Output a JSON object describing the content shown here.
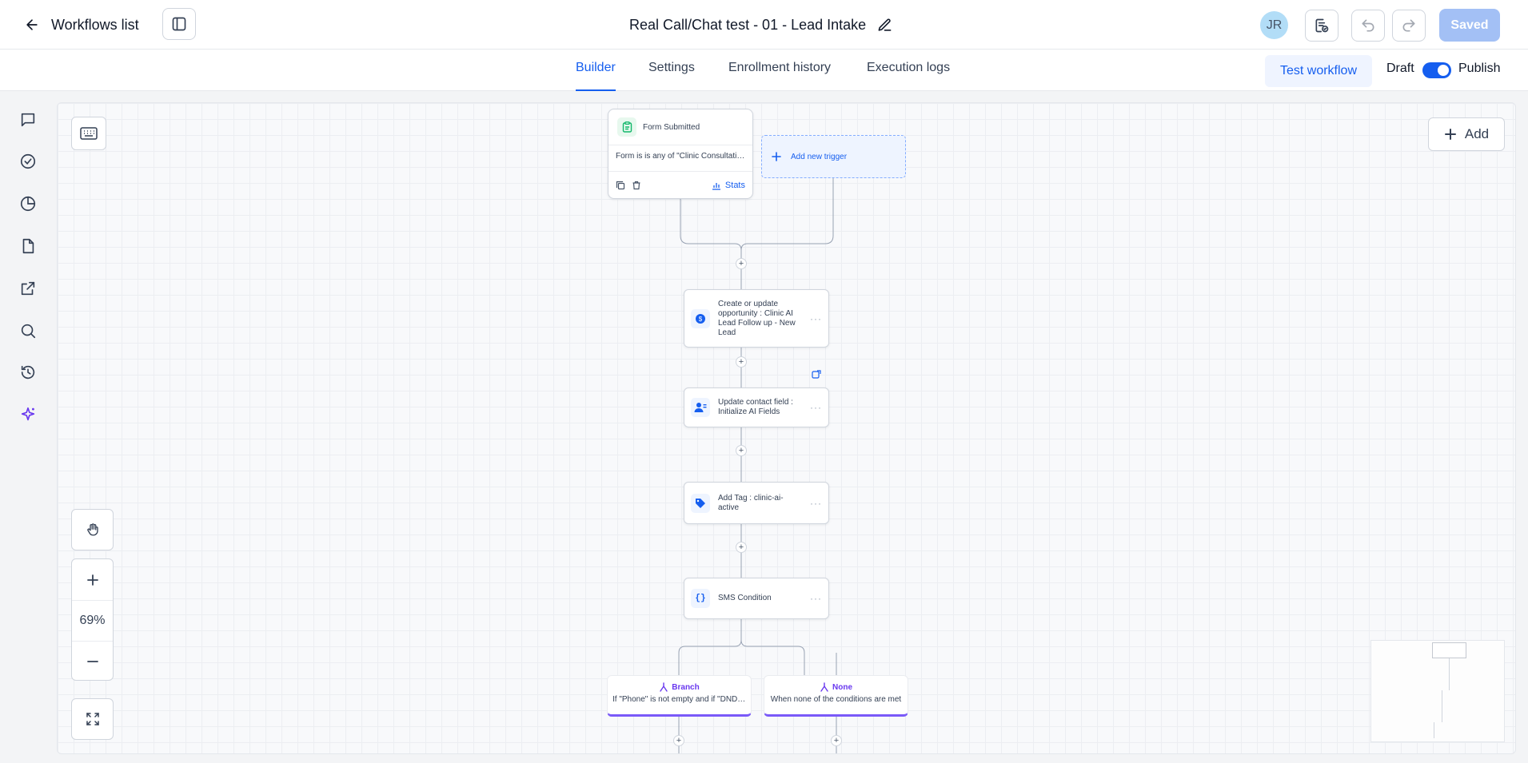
{
  "header": {
    "back_label": "Workflows list",
    "title": "Real Call/Chat test - 01 - Lead Intake",
    "avatar_initials": "JR",
    "saved_label": "Saved"
  },
  "tabs": [
    {
      "label": "Builder",
      "active": true
    },
    {
      "label": "Settings",
      "active": false
    },
    {
      "label": "Enrollment history",
      "active": false
    },
    {
      "label": "Execution logs",
      "active": false
    }
  ],
  "publish": {
    "test_label": "Test workflow",
    "draft_label": "Draft",
    "publish_label": "Publish",
    "published": true
  },
  "rail": {
    "icons": [
      "chat-icon",
      "check-circle-icon",
      "pie-chart-icon",
      "file-icon",
      "share-icon",
      "search-icon",
      "history-icon",
      "sparkle-icon"
    ]
  },
  "canvas": {
    "add_label": "Add",
    "zoom_level": "69%",
    "trigger": {
      "title": "Form Submitted",
      "condition": "Form is is any of \"Clinic Consultation Form\"",
      "stats_label": "Stats"
    },
    "new_trigger_label": "Add new trigger",
    "actions": [
      {
        "label": "Create or update opportunity : Clinic AI Lead Follow up - New Lead",
        "icon": "dollar-icon"
      },
      {
        "label": "Update contact field : Initialize AI Fields",
        "icon": "contact-icon"
      },
      {
        "label": "Add Tag : clinic-ai-active",
        "icon": "tag-icon"
      },
      {
        "label": "SMS Condition",
        "icon": "braces-icon"
      }
    ],
    "branches": [
      {
        "title": "Branch",
        "description": "If \"Phone\" is not empty and if \"DND enabled\" is false"
      },
      {
        "title": "None",
        "description": "When none of the conditions are met"
      }
    ]
  },
  "colors": {
    "accent": "#155eef",
    "branch_accent": "#7a5af8",
    "saved_button": "#a3c0f5"
  }
}
